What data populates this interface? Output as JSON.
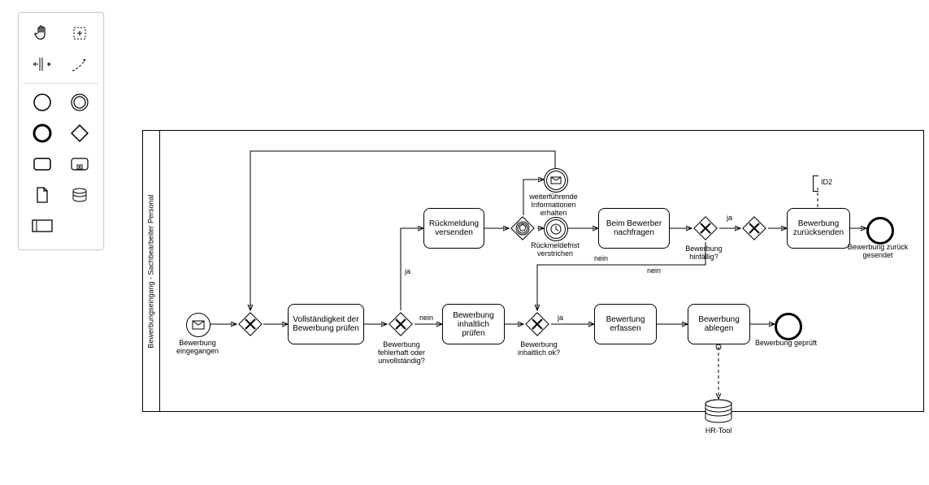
{
  "lane": {
    "title": "Bewerbungseingang - Sachbearbeiter Personal"
  },
  "events": {
    "start": {
      "label": "Bewerbung eingegangen"
    },
    "infoReceived": {
      "label": "weiterführende Informationen erhalten"
    },
    "deadline": {
      "label": "Rückmeldefrist verstrichen"
    },
    "endSent": {
      "label": "Bewerbung zurück gesendet"
    },
    "endChecked": {
      "label": "Bewerbung geprüft"
    }
  },
  "tasks": {
    "checkComplete": "Vollständigkeit der Bewerbung prüfen",
    "sendFeedback": "Rückmeldung versenden",
    "checkContent": "Bewerbung inhaltlich prüfen",
    "askApplicant": "Beim Bewerber nachfragen",
    "recordRating": "Bewertung erfassen",
    "fileApp": "Bewerbung ablegen",
    "returnApp": "Bewerbung zurücksenden"
  },
  "gateways": {
    "merge1": "",
    "faulty": "Bewerbung fehlerhaft oder unvollständig?",
    "eventBased": "",
    "contentOk": "Bewerbung inhaltlich ok?",
    "obsolete": "Bewerbung hinfällig?",
    "merge2": ""
  },
  "flowLabels": {
    "ja1": "ja",
    "nein1": "nein",
    "ja2": "ja",
    "nein2": "nein",
    "ja3": "ja",
    "nein3": "nein"
  },
  "dataStore": {
    "label": "HR-Tool"
  },
  "annotation": {
    "id2": "ID2"
  },
  "palette": {
    "hand": "hand-tool",
    "lasso": "lasso-tool",
    "space": "space-tool",
    "connect": "connect-tool",
    "startEvt": "start-event",
    "intermEvt": "intermediate-event",
    "endEvt": "end-event",
    "gateway": "gateway",
    "task": "task",
    "subprocess": "subprocess",
    "dataObj": "data-object",
    "dataStore": "data-store",
    "participant": "participant"
  }
}
